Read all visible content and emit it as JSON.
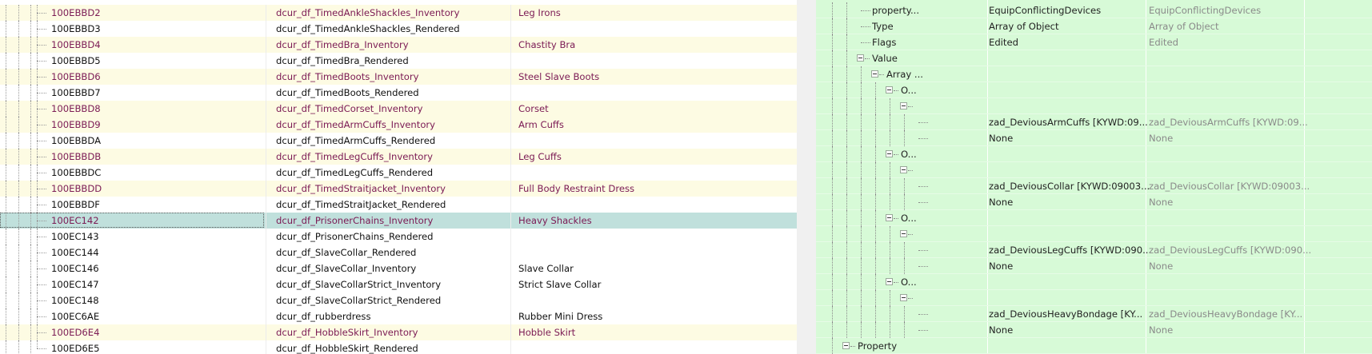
{
  "records": [
    {
      "form_id": "100EBBD2",
      "editor_id": "dcur_df_TimedAnkleShackles_Inventory",
      "name": "Leg Irons",
      "style": "hl"
    },
    {
      "form_id": "100EBBD3",
      "editor_id": "dcur_df_TimedAnkleShackles_Rendered",
      "name": "",
      "style": ""
    },
    {
      "form_id": "100EBBD4",
      "editor_id": "dcur_df_TimedBra_Inventory",
      "name": "Chastity Bra",
      "style": "hl"
    },
    {
      "form_id": "100EBBD5",
      "editor_id": "dcur_df_TimedBra_Rendered",
      "name": "",
      "style": ""
    },
    {
      "form_id": "100EBBD6",
      "editor_id": "dcur_df_TimedBoots_Inventory",
      "name": "Steel Slave Boots",
      "style": "hl"
    },
    {
      "form_id": "100EBBD7",
      "editor_id": "dcur_df_TimedBoots_Rendered",
      "name": "",
      "style": ""
    },
    {
      "form_id": "100EBBD8",
      "editor_id": "dcur_df_TimedCorset_Inventory",
      "name": "Corset",
      "style": "hl"
    },
    {
      "form_id": "100EBBD9",
      "editor_id": "dcur_df_TimedArmCuffs_Inventory",
      "name": "Arm Cuffs",
      "style": "hl"
    },
    {
      "form_id": "100EBBDA",
      "editor_id": "dcur_df_TimedArmCuffs_Rendered",
      "name": "",
      "style": ""
    },
    {
      "form_id": "100EBBDB",
      "editor_id": "dcur_df_TimedLegCuffs_Inventory",
      "name": "Leg Cuffs",
      "style": "hl"
    },
    {
      "form_id": "100EBBDC",
      "editor_id": "dcur_df_TimedLegCuffs_Rendered",
      "name": "",
      "style": ""
    },
    {
      "form_id": "100EBBDD",
      "editor_id": "dcur_df_TimedStraitjacket_Inventory",
      "name": "Full Body Restraint Dress",
      "style": "hl"
    },
    {
      "form_id": "100EBBDF",
      "editor_id": "dcur_df_TimedStraitJacket_Rendered",
      "name": "",
      "style": ""
    },
    {
      "form_id": "100EC142",
      "editor_id": "dcur_df_PrisonerChains_Inventory",
      "name": "Heavy Shackles",
      "style": "sel"
    },
    {
      "form_id": "100EC143",
      "editor_id": "dcur_df_PrisonerChains_Rendered",
      "name": "",
      "style": ""
    },
    {
      "form_id": "100EC144",
      "editor_id": "dcur_df_SlaveCollar_Rendered",
      "name": "",
      "style": ""
    },
    {
      "form_id": "100EC146",
      "editor_id": "dcur_df_SlaveCollar_Inventory",
      "name": "Slave Collar",
      "style": ""
    },
    {
      "form_id": "100EC147",
      "editor_id": "dcur_df_SlaveCollarStrict_Inventory",
      "name": "Strict Slave Collar",
      "style": ""
    },
    {
      "form_id": "100EC148",
      "editor_id": "dcur_df_SlaveCollarStrict_Rendered",
      "name": "",
      "style": ""
    },
    {
      "form_id": "100EC6AE",
      "editor_id": "dcur_df_rubberdress",
      "name": "Rubber Mini Dress",
      "style": ""
    },
    {
      "form_id": "100ED6E4",
      "editor_id": "dcur_df_HobbleSkirt_Inventory",
      "name": "Hobble Skirt",
      "style": "hl"
    },
    {
      "form_id": "100ED6E5",
      "editor_id": "dcur_df_HobbleSkirt_Rendered",
      "name": "",
      "style": ""
    }
  ],
  "tree": [
    {
      "label": "property...",
      "value": "EquipConflictingDevices",
      "value2": "EquipConflictingDevices",
      "depth": 2,
      "expander": false
    },
    {
      "label": "Type",
      "value": "Array of Object",
      "value2": "Array of Object",
      "depth": 2,
      "expander": false
    },
    {
      "label": "Flags",
      "value": "Edited",
      "value2": "Edited",
      "depth": 2,
      "expander": false
    },
    {
      "label": "Value",
      "value": "",
      "value2": "",
      "depth": 2,
      "expander": true
    },
    {
      "label": "Array ...",
      "value": "",
      "value2": "",
      "depth": 3,
      "expander": true
    },
    {
      "label": "O...",
      "value": "",
      "value2": "",
      "depth": 4,
      "expander": true
    },
    {
      "label": "",
      "value": "",
      "value2": "",
      "depth": 5,
      "expander": true
    },
    {
      "label": "",
      "value": "zad_DeviousArmCuffs [KYWD:09...",
      "value2": "zad_DeviousArmCuffs [KYWD:09...",
      "depth": 6,
      "expander": false
    },
    {
      "label": "",
      "value": "None",
      "value2": "None",
      "depth": 6,
      "expander": false
    },
    {
      "label": "O...",
      "value": "",
      "value2": "",
      "depth": 4,
      "expander": true
    },
    {
      "label": "",
      "value": "",
      "value2": "",
      "depth": 5,
      "expander": true
    },
    {
      "label": "",
      "value": "zad_DeviousCollar [KYWD:09003...",
      "value2": "zad_DeviousCollar [KYWD:09003...",
      "depth": 6,
      "expander": false
    },
    {
      "label": "",
      "value": "None",
      "value2": "None",
      "depth": 6,
      "expander": false
    },
    {
      "label": "O...",
      "value": "",
      "value2": "",
      "depth": 4,
      "expander": true
    },
    {
      "label": "",
      "value": "",
      "value2": "",
      "depth": 5,
      "expander": true
    },
    {
      "label": "",
      "value": "zad_DeviousLegCuffs [KYWD:090...",
      "value2": "zad_DeviousLegCuffs [KYWD:090...",
      "depth": 6,
      "expander": false
    },
    {
      "label": "",
      "value": "None",
      "value2": "None",
      "depth": 6,
      "expander": false
    },
    {
      "label": "O...",
      "value": "",
      "value2": "",
      "depth": 4,
      "expander": true
    },
    {
      "label": "",
      "value": "",
      "value2": "",
      "depth": 5,
      "expander": true
    },
    {
      "label": "",
      "value": "zad_DeviousHeavyBondage [KY...",
      "value2": "zad_DeviousHeavyBondage [KY...",
      "depth": 6,
      "expander": false
    },
    {
      "label": "",
      "value": "None",
      "value2": "None",
      "depth": 6,
      "expander": false
    },
    {
      "label": "Property",
      "value": "",
      "value2": "",
      "depth": 1,
      "expander": true
    }
  ]
}
